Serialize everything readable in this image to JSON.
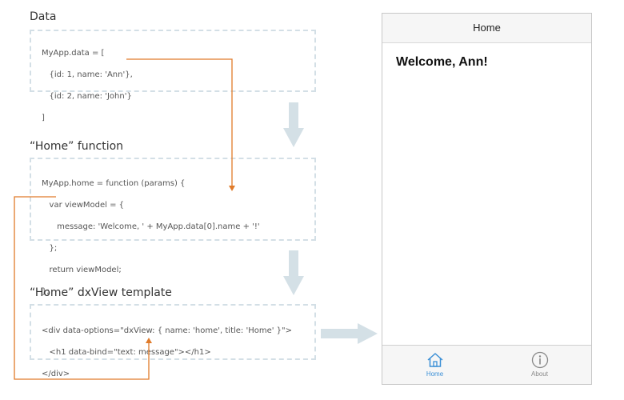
{
  "steps": {
    "data": {
      "heading": "Data",
      "code": [
        "MyApp.data = [",
        "   {id: 1, name: 'Ann'},",
        "   {id: 2, name: 'John'}",
        "]"
      ]
    },
    "function": {
      "heading": "“Home” function",
      "code": [
        "MyApp.home = function (params) {",
        "   var viewModel = {",
        "      message: 'Welcome, ' + MyApp.data[0].name + '!'",
        "   };",
        "   return viewModel;",
        "};"
      ]
    },
    "template": {
      "heading": "“Home” dxView template",
      "code": [
        "<div data-options=\"dxView: { name: 'home', title: 'Home' }\">",
        "   <h1 data-bind=\"text: message\"></h1>",
        "</div>"
      ]
    }
  },
  "phone": {
    "title": "Home",
    "message": "Welcome, Ann!",
    "tabs": [
      {
        "label": "Home",
        "icon": "home-icon",
        "active": true
      },
      {
        "label": "About",
        "icon": "info-icon",
        "active": false
      }
    ]
  },
  "colors": {
    "connector": "#e07b2a",
    "flow_arrow": "#d4e0e6",
    "box_border": "#d3dfe6",
    "tab_active": "#3a8fd6",
    "tab_inactive": "#888888"
  }
}
